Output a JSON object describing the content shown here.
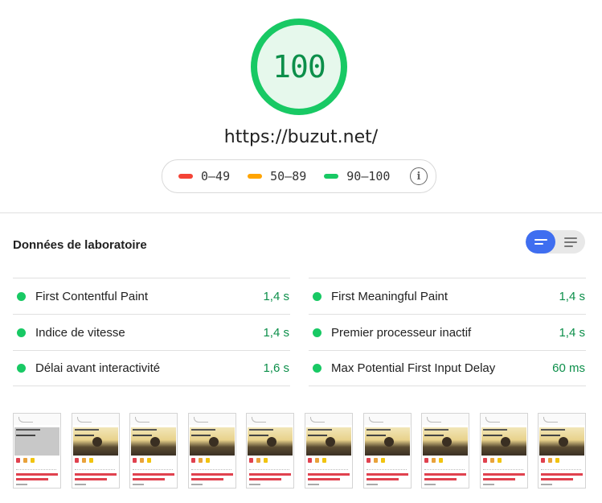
{
  "score": {
    "value": "100",
    "fraction": 1.0,
    "color": "#18c964",
    "text_color": "#0c8f4a"
  },
  "url": "https://buzut.net/",
  "legend": {
    "items": [
      {
        "label": "0–49",
        "color": "#f44336"
      },
      {
        "label": "50–89",
        "color": "#ffa400"
      },
      {
        "label": "90–100",
        "color": "#18c964"
      }
    ],
    "info_icon": "info-icon"
  },
  "lab": {
    "title": "Données de laboratoire",
    "toggle": {
      "active": "list-view",
      "icons": [
        "list-view-icon",
        "detail-view-icon"
      ]
    },
    "left": [
      {
        "label": "First Contentful Paint",
        "value": "1,4 s"
      },
      {
        "label": "Indice de vitesse",
        "value": "1,4 s"
      },
      {
        "label": "Délai avant interactivité",
        "value": "1,6 s"
      }
    ],
    "right": [
      {
        "label": "First Meaningful Paint",
        "value": "1,4 s"
      },
      {
        "label": "Premier processeur inactif",
        "value": "1,4 s"
      },
      {
        "label": "Max Potential First Input Delay",
        "value": "60 ms"
      }
    ]
  },
  "filmstrip": {
    "frames": [
      {
        "hero": "grey"
      },
      {
        "hero": "photo"
      },
      {
        "hero": "photo"
      },
      {
        "hero": "photo"
      },
      {
        "hero": "photo"
      },
      {
        "hero": "photo"
      },
      {
        "hero": "photo"
      },
      {
        "hero": "photo"
      },
      {
        "hero": "photo"
      },
      {
        "hero": "photo"
      }
    ]
  }
}
